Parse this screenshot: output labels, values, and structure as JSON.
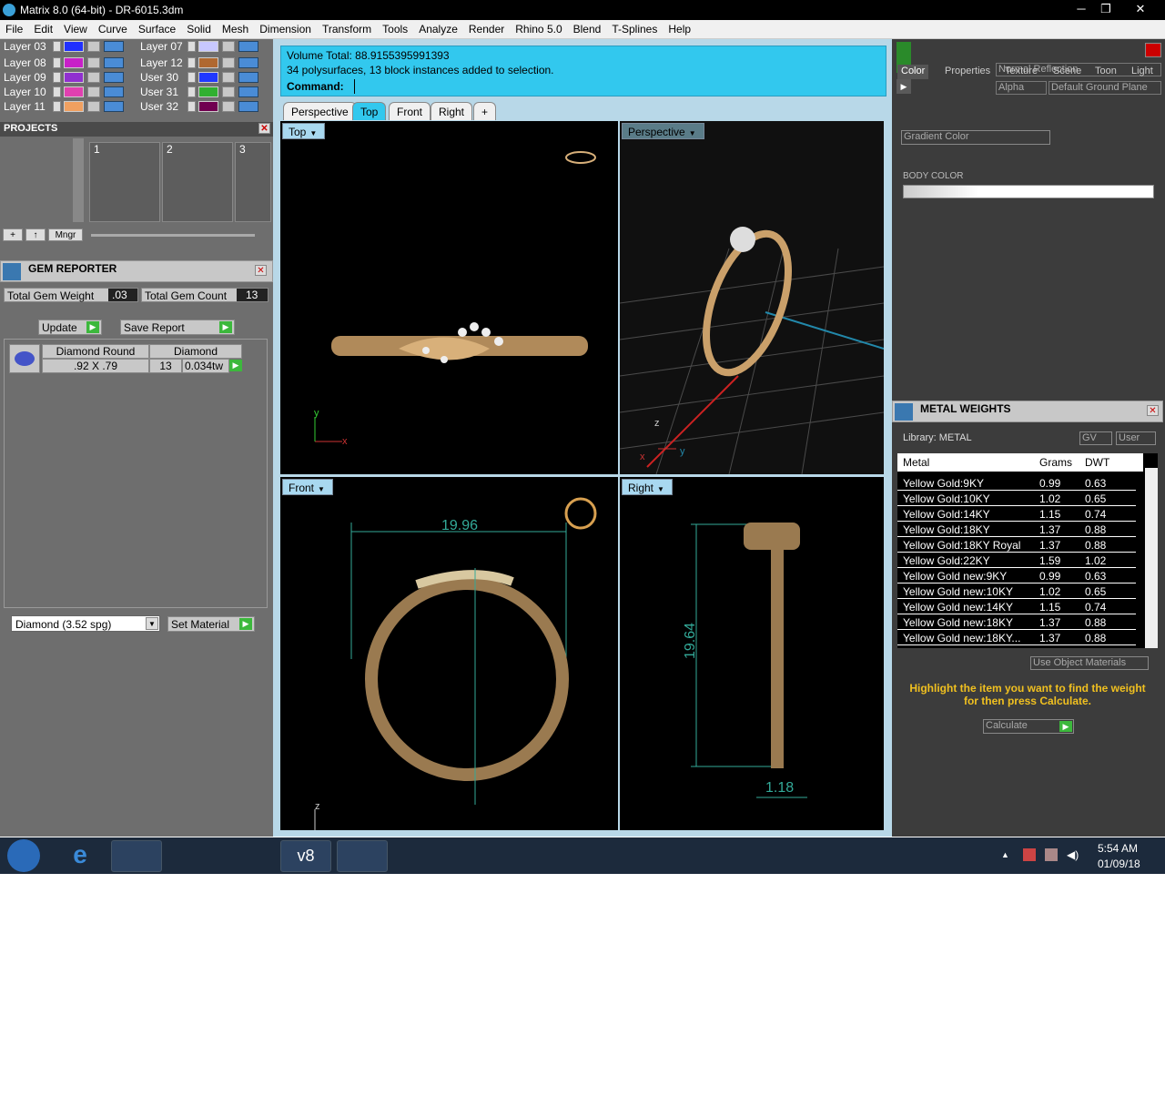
{
  "window": {
    "title": "Matrix 8.0 (64-bit) - DR-6015.3dm",
    "minimize": "─",
    "restore": "❐",
    "close": "✕"
  },
  "menu": [
    "File",
    "Edit",
    "View",
    "Curve",
    "Surface",
    "Solid",
    "Mesh",
    "Dimension",
    "Transform",
    "Tools",
    "Analyze",
    "Render",
    "Rhino 5.0",
    "Blend",
    "T-Splines",
    "Help"
  ],
  "layers": [
    {
      "name": "Layer 03",
      "color": "#2030ff"
    },
    {
      "name": "Layer 07",
      "color": "#c8c8ff"
    },
    {
      "name": "Layer 08",
      "color": "#c820c8"
    },
    {
      "name": "Layer 12",
      "color": "#b06830"
    },
    {
      "name": "Layer 09",
      "color": "#9030d0"
    },
    {
      "name": "User 30",
      "color": "#2038ff"
    },
    {
      "name": "Layer 10",
      "color": "#e040b0"
    },
    {
      "name": "User 31",
      "color": "#30b030"
    },
    {
      "name": "Layer 11",
      "color": "#f0a060"
    },
    {
      "name": "User 32",
      "color": "#700050"
    }
  ],
  "projects": {
    "title": "PROJECTS",
    "items": [
      "1",
      "2",
      "3"
    ],
    "manager": "Mngr",
    "plus": "+",
    "up": "↑"
  },
  "gem_reporter": {
    "title": "GEM REPORTER",
    "total_weight_label": "Total Gem Weight",
    "total_weight": ".03",
    "total_count_label": "Total Gem Count",
    "total_count": "13",
    "update": "Update",
    "save_report": "Save Report",
    "gem_shape": "Diamond Round",
    "gem_size": ".92 X .79",
    "gem_type": "Diamond",
    "gem_qty": "13",
    "gem_wt": "0.034tw",
    "material": "Diamond    (3.52 spg)",
    "set_material": "Set Material"
  },
  "command": {
    "line1": "Volume Total: 88.9155395991393",
    "line2": "34 polysurfaces, 13 block instances added to selection.",
    "prompt": "Command:"
  },
  "view_tabs": [
    "Perspective",
    "Top",
    "Front",
    "Right",
    "+"
  ],
  "viewports": {
    "top": {
      "label": "Top",
      "axis_y": "y",
      "axis_x": "x"
    },
    "perspective": {
      "label": "Perspective",
      "axis_z": "z",
      "axis_x": "x",
      "axis_y": "y"
    },
    "front": {
      "label": "Front",
      "dim": "19.96",
      "axis_z": "z"
    },
    "right": {
      "label": "Right",
      "dim_height": "19.64",
      "dim_width": "1.18"
    }
  },
  "render_panel": {
    "reflection": "Normal Reflection",
    "alpha": "Alpha",
    "ground": "Default Ground Plane",
    "tabs": [
      "Color",
      "Properties",
      "Texture",
      "Scene",
      "Toon",
      "Light"
    ],
    "gradient": "Gradient Color",
    "body_color": "BODY COLOR"
  },
  "metal_weights": {
    "title": "METAL WEIGHTS",
    "library": "Library: METAL",
    "gv": "GV",
    "user": "User",
    "columns": [
      "Metal",
      "Grams",
      "DWT"
    ],
    "rows": [
      [
        "Yellow Gold:9KY",
        "0.99",
        "0.63"
      ],
      [
        "Yellow Gold:10KY",
        "1.02",
        "0.65"
      ],
      [
        "Yellow Gold:14KY",
        "1.15",
        "0.74"
      ],
      [
        "Yellow Gold:18KY",
        "1.37",
        "0.88"
      ],
      [
        "Yellow Gold:18KY Royal",
        "1.37",
        "0.88"
      ],
      [
        "Yellow Gold:22KY",
        "1.59",
        "1.02"
      ],
      [
        "Yellow Gold new:9KY",
        "0.99",
        "0.63"
      ],
      [
        "Yellow Gold new:10KY",
        "1.02",
        "0.65"
      ],
      [
        "Yellow Gold new:14KY",
        "1.15",
        "0.74"
      ],
      [
        "Yellow Gold new:18KY",
        "1.37",
        "0.88"
      ],
      [
        "Yellow Gold new:18KY...",
        "1.37",
        "0.88"
      ]
    ],
    "use_object": "Use Object Materials",
    "hint": "Highlight the item you want to find the weight for then press Calculate.",
    "calculate": "Calculate"
  },
  "taskbar": {
    "time": "5:54 AM",
    "date": "01/09/18",
    "v8": "v8"
  }
}
